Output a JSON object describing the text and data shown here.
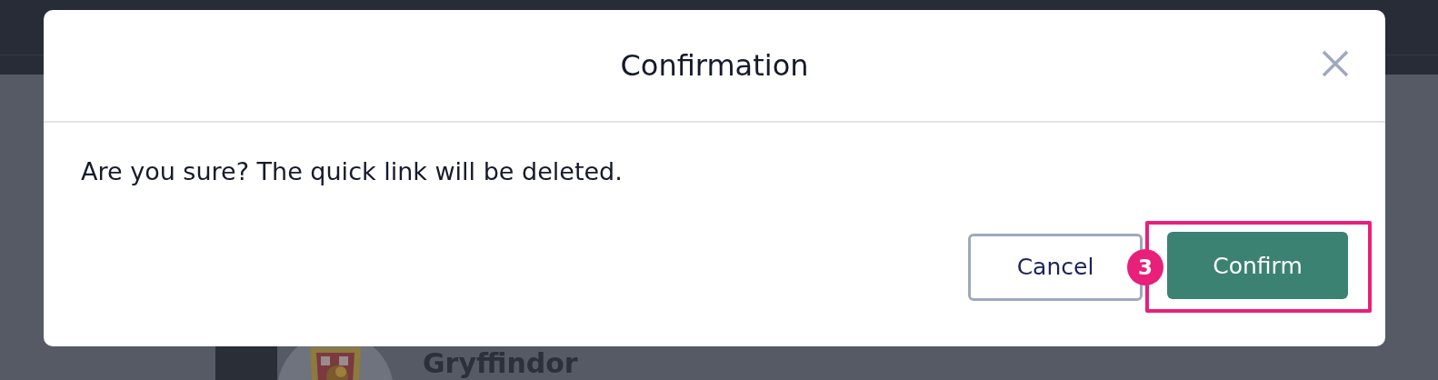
{
  "background": {
    "heading": "Gryffindor"
  },
  "dialog": {
    "title": "Confirmation",
    "message": "Are you sure? The quick link will be deleted.",
    "buttons": [
      {
        "label": "Cancel",
        "kind": "secondary",
        "highlighted": false
      },
      {
        "label": "Confirm",
        "kind": "primary",
        "highlighted": true,
        "callout": "3"
      }
    ]
  }
}
